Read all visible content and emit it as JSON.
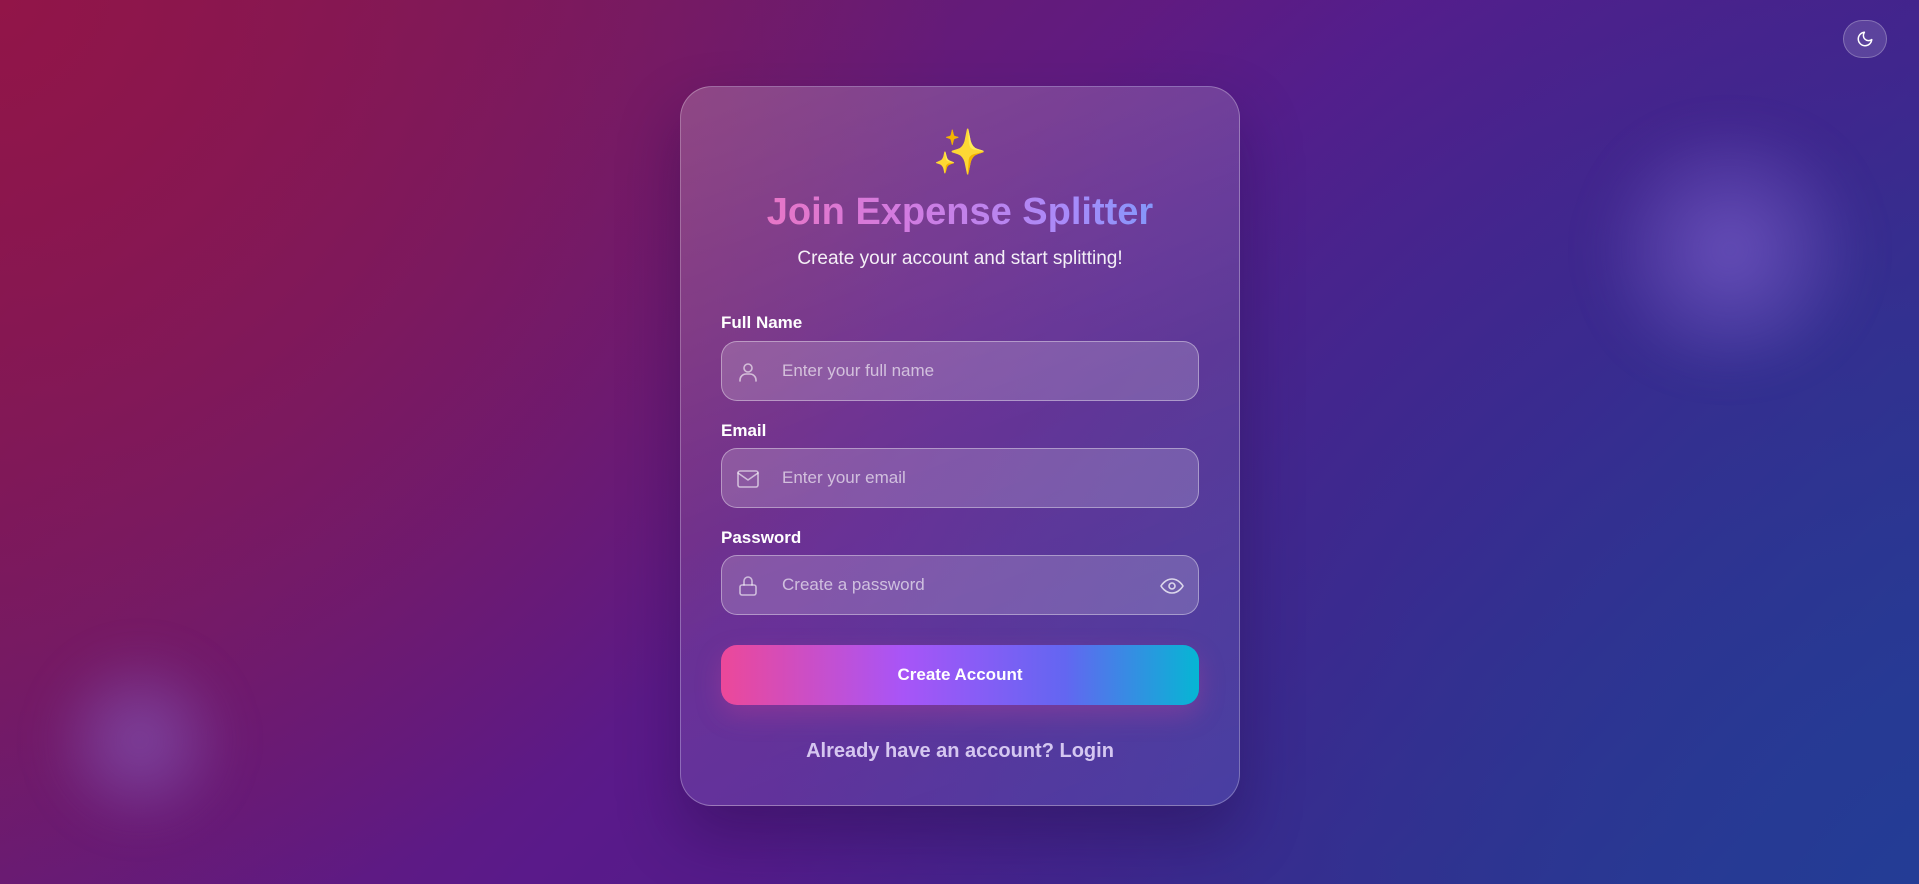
{
  "theme_toggle": {
    "icon": "moon-icon"
  },
  "header": {
    "emoji": "✨",
    "title": "Join Expense Splitter",
    "subtitle": "Create your account and start splitting!"
  },
  "form": {
    "full_name": {
      "label": "Full Name",
      "placeholder": "Enter your full name",
      "value": "",
      "icon": "user-icon"
    },
    "email": {
      "label": "Email",
      "placeholder": "Enter your email",
      "value": "",
      "icon": "mail-icon"
    },
    "password": {
      "label": "Password",
      "placeholder": "Create a password",
      "value": "",
      "icon": "lock-icon",
      "toggle_icon": "eye-icon"
    },
    "submit_label": "Create Account"
  },
  "footer": {
    "prompt": "Already have an account?",
    "login_label": "Login"
  },
  "colors": {
    "title_gradient_start": "#f472b6",
    "title_gradient_end": "#60a5fa",
    "button_gradient_start": "#ec4899",
    "button_gradient_end": "#06b6d4"
  }
}
